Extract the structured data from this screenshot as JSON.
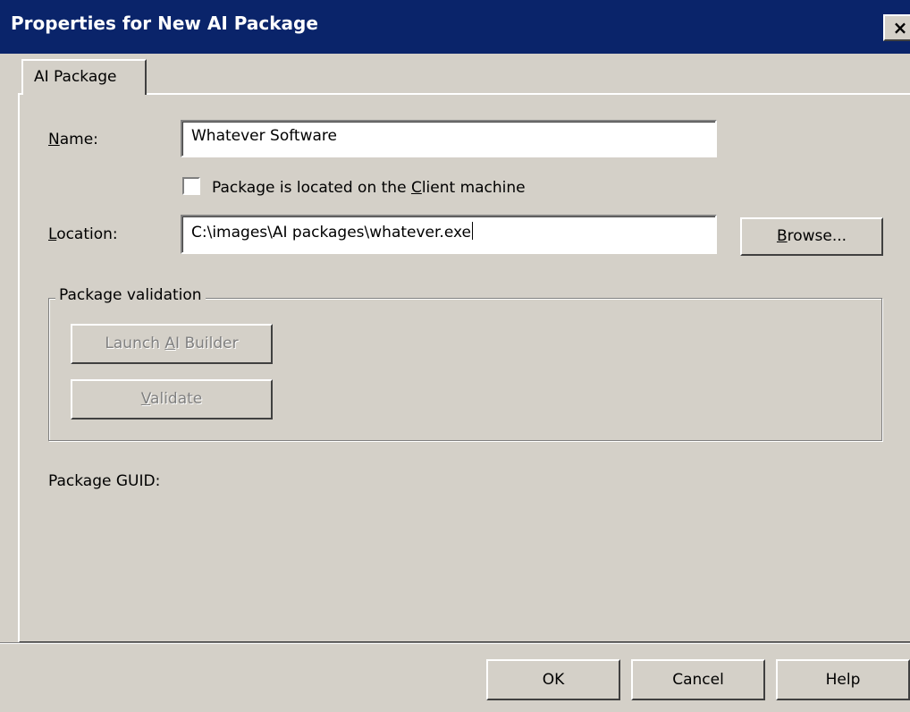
{
  "window": {
    "title": "Properties for New AI Package",
    "close_glyph": "×"
  },
  "tab": {
    "label": "AI Package"
  },
  "name_field": {
    "label_mnemonic": "N",
    "label_rest": "ame:",
    "value": "Whatever Software"
  },
  "client_checkbox": {
    "label_before": "Package is located on the ",
    "label_mnemonic": "C",
    "label_after": "lient machine",
    "checked": false
  },
  "location_field": {
    "label_mnemonic": "L",
    "label_rest": "ocation:",
    "value": "C:\\images\\AI packages\\whatever.exe"
  },
  "browse_button": {
    "label_mnemonic": "B",
    "label_rest": "rowse..."
  },
  "validation_group": {
    "legend": "Package validation",
    "launch_button": {
      "label_before": "Launch ",
      "label_mnemonic": "A",
      "label_after": "I Builder"
    },
    "validate_button": {
      "label_mnemonic": "V",
      "label_rest": "alidate"
    }
  },
  "guid": {
    "label": "Package GUID:"
  },
  "footer": {
    "ok_label": "OK",
    "cancel_label": "Cancel",
    "help_label": "Help"
  },
  "colors": {
    "titlebar": "#0a246a",
    "dialog_face": "#d4d0c8",
    "disabled_text": "#808080"
  }
}
